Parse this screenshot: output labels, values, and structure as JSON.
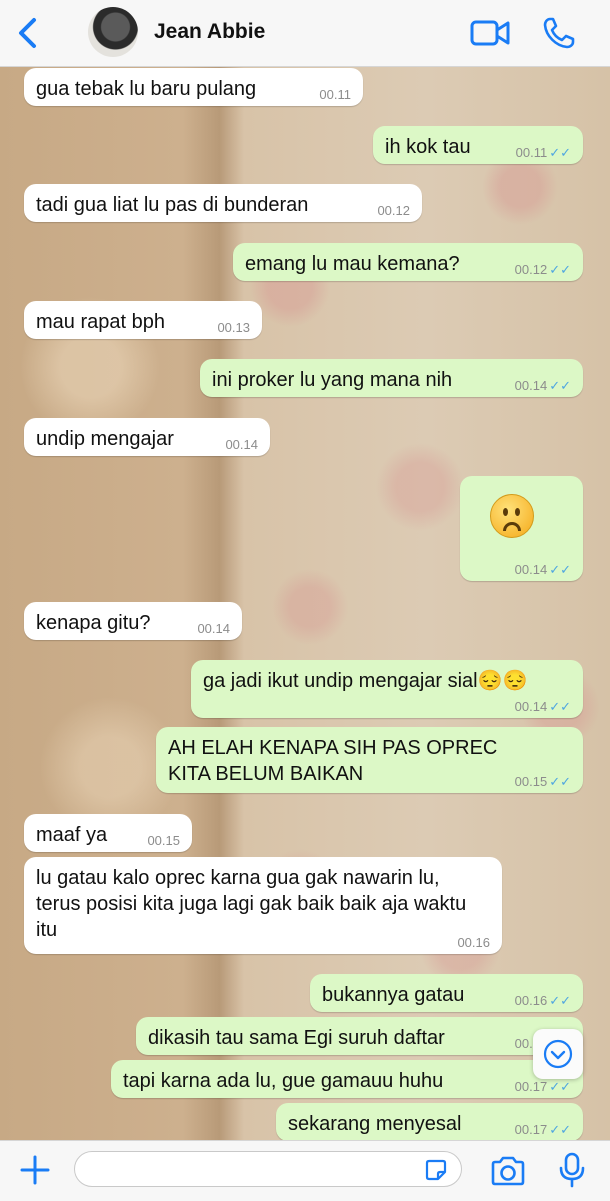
{
  "header": {
    "contact_name": "Jean Abbie",
    "icons": [
      "back-chevron-icon",
      "avatar",
      "video-call-icon",
      "phone-call-icon"
    ],
    "accent_color": "#1a7cf5"
  },
  "messages": [
    {
      "dir": "in",
      "text": "gua tebak lu baru pulang",
      "time": "00.11"
    },
    {
      "dir": "out",
      "text": "ih kok tau",
      "time": "00.11",
      "ticks": "✓✓"
    },
    {
      "dir": "in",
      "text": "tadi gua liat lu pas di bunderan",
      "time": "00.12"
    },
    {
      "dir": "out",
      "text": "emang lu mau kemana?",
      "time": "00.12",
      "ticks": "✓✓"
    },
    {
      "dir": "in",
      "text": "mau rapat bph",
      "time": "00.13"
    },
    {
      "dir": "out",
      "text": "ini proker lu yang mana nih",
      "time": "00.14",
      "ticks": "✓✓"
    },
    {
      "dir": "in",
      "text": "undip mengajar",
      "time": "00.14"
    },
    {
      "dir": "out",
      "emoji": "frowning-face-emoji",
      "time": "00.14",
      "ticks": "✓✓"
    },
    {
      "dir": "in",
      "text": "kenapa gitu?",
      "time": "00.14"
    },
    {
      "dir": "out",
      "text": "ga jadi ikut undip mengajar sial😔😔",
      "time": "00.14",
      "ticks": "✓✓"
    },
    {
      "dir": "out",
      "text": "AH ELAH KENAPA SIH PAS OPREC KITA BELUM BAIKAN",
      "time": "00.15",
      "ticks": "✓✓"
    },
    {
      "dir": "in",
      "text": "maaf ya",
      "time": "00.15"
    },
    {
      "dir": "in",
      "text": "lu gatau kalo oprec karna gua gak nawarin lu, terus posisi kita juga lagi gak baik baik aja waktu itu",
      "time": "00.16"
    },
    {
      "dir": "out",
      "text": "bukannya gatau",
      "time": "00.16",
      "ticks": "✓✓"
    },
    {
      "dir": "out",
      "text": "dikasih tau sama Egi suruh daftar",
      "time": "00.16",
      "ticks": "✓✓"
    },
    {
      "dir": "out",
      "text": "tapi karna ada lu, gue gamauu huhu",
      "time": "00.17",
      "ticks": "✓✓"
    },
    {
      "dir": "out",
      "text": "sekarang menyesal",
      "time": "00.17",
      "ticks": "✓✓"
    }
  ],
  "input_bar": {
    "placeholder": "",
    "icons": [
      "plus-icon",
      "sticker-icon",
      "camera-icon",
      "microphone-icon"
    ]
  },
  "colors": {
    "incoming_bubble": "#ffffff",
    "outgoing_bubble": "#dcf8c6",
    "read_ticks": "#4fa6e0",
    "timestamp": "#8c8c8c"
  }
}
